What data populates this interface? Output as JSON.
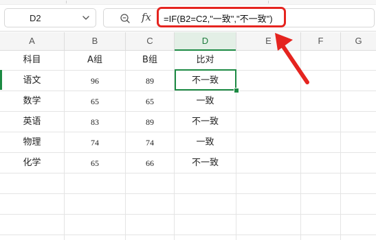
{
  "name_box": {
    "cell_ref": "D2"
  },
  "formula_bar": {
    "fx_label": "fx",
    "formula": "=IF(B2=C2,\"一致\",\"不一致\")"
  },
  "columns": [
    "A",
    "B",
    "C",
    "D",
    "E",
    "F",
    "G"
  ],
  "active_column": "D",
  "header_row": {
    "subject": "科目",
    "group_a": "A组",
    "group_b": "B组",
    "compare": "比对"
  },
  "rows": [
    {
      "subject": "语文",
      "a": "96",
      "b": "89",
      "result": "不一致"
    },
    {
      "subject": "数学",
      "a": "65",
      "b": "65",
      "result": "一致"
    },
    {
      "subject": "英语",
      "a": "83",
      "b": "89",
      "result": "不一致"
    },
    {
      "subject": "物理",
      "a": "74",
      "b": "74",
      "result": "一致"
    },
    {
      "subject": "化学",
      "a": "65",
      "b": "66",
      "result": "不一致"
    }
  ],
  "colors": {
    "highlight": "#e5241f",
    "selection": "#1c8a43"
  },
  "icons": {
    "name_box_dropdown": "chevron-down-icon",
    "zoom": "zoom-icon",
    "annotation": "arrow-icon"
  }
}
